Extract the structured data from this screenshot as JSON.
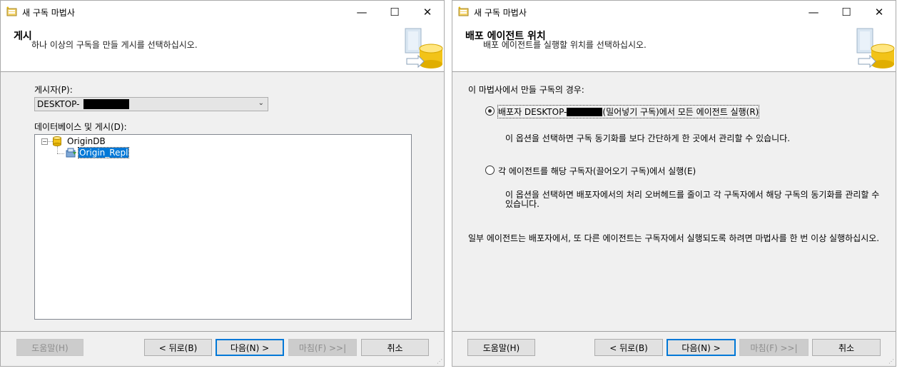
{
  "window1": {
    "title": "새 구독 마법사",
    "header_title": "게시",
    "header_desc": "하나 이상의 구독을 만들 게시를 선택하십시오.",
    "publisher_label": "게시자(P):",
    "publisher_value": "DESKTOP-",
    "databases_label": "데이터베이스 및 게시(D):",
    "tree": {
      "database": "OriginDB",
      "publication": "Origin_Repl"
    },
    "buttons": {
      "help": "도움말(H)",
      "back": "< 뒤로(B)",
      "next": "다음(N) >",
      "finish": "마침(F) >>|",
      "cancel": "취소"
    }
  },
  "window2": {
    "title": "새 구독 마법사",
    "header_title": "배포 에이전트 위치",
    "header_desc": "배포 에이전트를 실행할 위치를 선택하십시오.",
    "intro": "이 마법사에서 만들 구독의 경우:",
    "option_push": {
      "label_before": "배포자 DESKTOP-",
      "label_after": "(밀어넣기 구독)에서 모든 에이전트 실행(R)",
      "description": "이 옵션을 선택하면 구독 동기화를 보다 간단하게 한 곳에서 관리할 수 있습니다.",
      "checked": true
    },
    "option_pull": {
      "label": "각 에이전트를 해당 구독자(끌어오기 구독)에서 실행(E)",
      "description": "이 옵션을 선택하면 배포자에서의 처리 오버헤드를 줄이고 각 구독자에서 해당 구독의 동기화를 관리할 수 있습니다.",
      "checked": false
    },
    "footnote": "일부 에이전트는 배포자에서, 또 다른 에이전트는 구독자에서 실행되도록 하려면 마법사를 한 번 이상 실행하십시오.",
    "buttons": {
      "help": "도움말(H)",
      "back": "< 뒤로(B)",
      "next": "다음(N) >",
      "finish": "마침(F) >>|",
      "cancel": "취소"
    }
  }
}
